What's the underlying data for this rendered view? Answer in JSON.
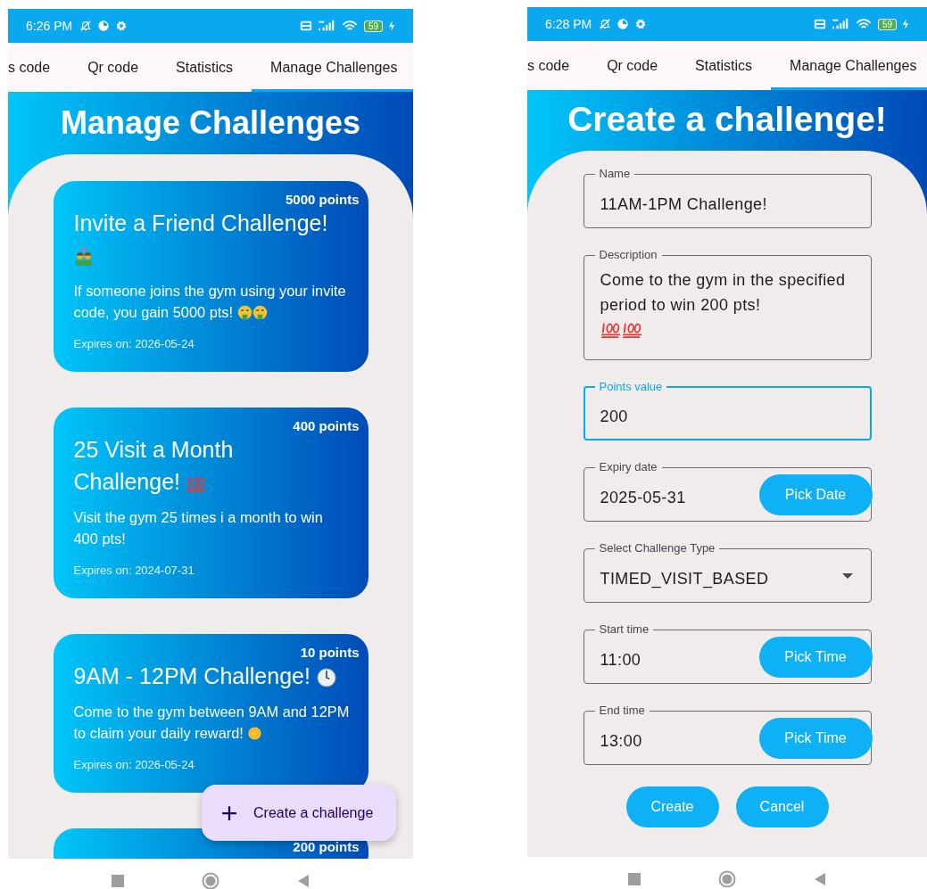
{
  "screens": [
    {
      "kind": "list",
      "status_bar": {
        "time": "6:26 PM",
        "battery": "59"
      },
      "tabs": [
        {
          "label": "s code",
          "selected": false
        },
        {
          "label": "Qr code",
          "selected": false
        },
        {
          "label": "Statistics",
          "selected": false
        },
        {
          "label": "Manage Challenges",
          "selected": true
        }
      ],
      "title": "Manage Challenges",
      "challenges": [
        {
          "points": "5000 points",
          "title": "Invite a Friend Challenge!",
          "description": "If someone joins the gym using your invite code, you gain 5000 pts!",
          "expires": "Expires on: 2026-05-24"
        },
        {
          "points": "400 points",
          "title": "25 Visit a Month Challenge!",
          "description": "Visit the gym 25 times i a month to win 400 pts!",
          "expires": "Expires on: 2024-07-31"
        },
        {
          "points": "10 points",
          "title": "9AM - 12PM Challenge!",
          "description": "Come to the gym between 9AM and 12PM to claim your daily reward!",
          "expires": "Expires on: 2026-05-24"
        },
        {
          "points": "200 points"
        }
      ],
      "fab": {
        "label": "Create a challenge"
      }
    },
    {
      "kind": "form",
      "status_bar": {
        "time": "6:28 PM",
        "battery": "59"
      },
      "tabs": [
        {
          "label": "s code",
          "selected": false
        },
        {
          "label": "Qr code",
          "selected": false
        },
        {
          "label": "Statistics",
          "selected": false
        },
        {
          "label": "Manage Challenges",
          "selected": true
        }
      ],
      "title": "Create a challenge!",
      "fields": [
        {
          "kind": "text",
          "label": "Name",
          "value": "11AM-1PM Challenge!",
          "focused": false
        },
        {
          "kind": "multiline",
          "label": "Description",
          "value": "Come to the gym in the specified period to win 200 pts!",
          "focused": false
        },
        {
          "kind": "text",
          "label": "Points value",
          "value": "200",
          "focused": true
        },
        {
          "kind": "button",
          "label": "Expiry date",
          "value": "2025-05-31",
          "button": "Pick Date",
          "focused": false
        },
        {
          "kind": "dropdown",
          "label": "Select Challenge Type",
          "value": "TIMED_VISIT_BASED",
          "focused": false
        },
        {
          "kind": "button",
          "label": "Start time",
          "value": "11:00",
          "button": "Pick Time",
          "focused": false
        },
        {
          "kind": "button",
          "label": "End time",
          "value": "13:00",
          "button": "Pick Time",
          "focused": false
        }
      ],
      "buttons": [
        "Create",
        "Cancel"
      ]
    }
  ]
}
